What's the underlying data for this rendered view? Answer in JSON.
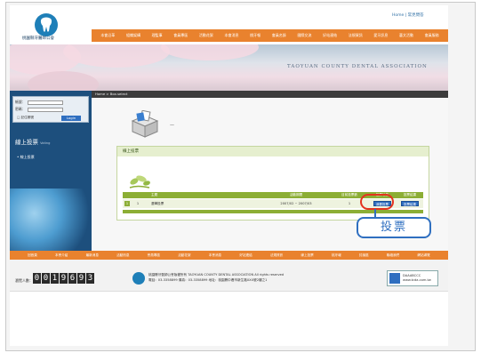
{
  "header": {
    "org_name": "桃園縣牙醫師公會",
    "top_links": "Home | 常見問答",
    "nav": [
      "本會沿革",
      "組織架構",
      "理監事",
      "會員專區",
      "活動花絮",
      "本會消息",
      "桃牙報",
      "會員名錄",
      "國際交流",
      "好站連結",
      "法規資訊",
      "愛牙訊息",
      "藝文活動",
      "會員服務"
    ],
    "banner_text": "TAOYUAN COUNTY DENTAL ASSOCIATION"
  },
  "sidebar": {
    "account_label": "帳號：",
    "password_label": "密碼：",
    "remember_label": "□ 記住帳號",
    "login_button": "Login",
    "title": "線上投票",
    "title_small": "Voting",
    "item": "線上投票"
  },
  "breadcrumb": "Home > Box.select",
  "content": {
    "dash": "—",
    "section_title": "線上投票",
    "columns": [
      "",
      "",
      "主題",
      "活動期間",
      "目前投票數",
      "投票功能",
      "投票結果"
    ],
    "rows": [
      {
        "num": "1",
        "idx": "1",
        "topic": "選舉投票",
        "period": "2007/02 ~ 2007/03",
        "count": "1",
        "vote": "我要投票",
        "result": "投票結果"
      }
    ]
  },
  "callout": "投票",
  "footer": {
    "nav": [
      "回首頁",
      "本會介紹",
      "最新消息",
      "活動訊息",
      "會員專區",
      "活動花絮",
      "本會消息",
      "好站連結",
      "法規資訊",
      "線上投票",
      "桃牙報",
      "討論區",
      "聯絡我們",
      "網站導覽"
    ],
    "counter_label": "瀏覽人數：",
    "counter_digits": [
      "0",
      "0",
      "1",
      "9",
      "6",
      "9",
      "3"
    ],
    "info_line1": "桃園縣牙醫師公會版權所有 TAOYUAN COUNTY DENTAL ASSOCIATION All rights reserved",
    "info_line2": "電話：03-3358899 傳真：03-3358899 地址：桃園縣中壢市新生路XXX號2樓之1",
    "badge_line1": "DAAABCCC",
    "badge_line2": "www.tcda.com.tw"
  },
  "colors": {
    "orange": "#e9822e",
    "navy": "#1d4f7d",
    "green": "#8cae35",
    "accent_red": "#e4331f",
    "link_blue": "#2f6fc0"
  }
}
